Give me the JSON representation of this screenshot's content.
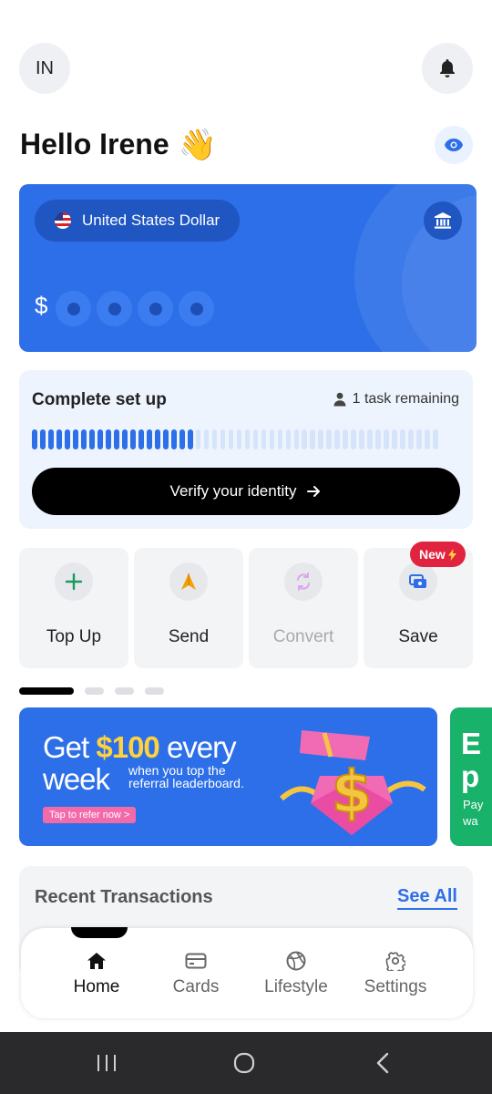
{
  "header": {
    "avatar_initials": "IN",
    "greeting": "Hello Irene",
    "greeting_emoji": "👋"
  },
  "balance_card": {
    "currency_label": "United States Dollar",
    "currency_symbol": "$",
    "hidden_digits": 4,
    "color": "#2d6fe8"
  },
  "setup": {
    "title": "Complete set up",
    "remaining": "1 task remaining",
    "progress_fraction": 0.4,
    "button_label": "Verify your identity"
  },
  "actions": [
    {
      "label": "Top Up",
      "icon": "plus-icon",
      "enabled": true
    },
    {
      "label": "Send",
      "icon": "send-arrow-icon",
      "enabled": true
    },
    {
      "label": "Convert",
      "icon": "convert-icon",
      "enabled": false
    },
    {
      "label": "Save",
      "icon": "savings-icon",
      "enabled": true
    }
  ],
  "new_badge": "New",
  "carousel": {
    "pages": 4,
    "active_page": 1,
    "banner": {
      "line1_prefix": "Get ",
      "amount": "$100",
      "line1_suffix": " every",
      "line2": "week",
      "subtitle_line1": "when you top the",
      "subtitle_line2": "referral leaderboard.",
      "cta": "Tap to refer now >"
    },
    "next_banner": {
      "big_line1": "E",
      "big_line2": "p",
      "small_line1": "Pay",
      "small_line2": "wa"
    }
  },
  "transactions": {
    "title": "Recent Transactions",
    "see_all": "See All"
  },
  "bottom_nav": [
    {
      "label": "Home",
      "icon": "home-icon",
      "active": true
    },
    {
      "label": "Cards",
      "icon": "card-icon",
      "active": false
    },
    {
      "label": "Lifestyle",
      "icon": "basketball-icon",
      "active": false
    },
    {
      "label": "Settings",
      "icon": "gear-icon",
      "active": false
    }
  ],
  "colors": {
    "accent": "#2d6fe8",
    "badge": "#e0243f",
    "promo_green": "#19b26b"
  }
}
